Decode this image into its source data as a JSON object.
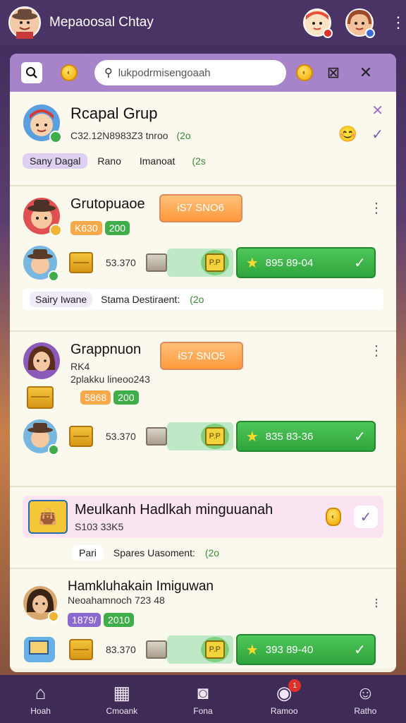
{
  "header": {
    "title": "Mepaoosal Chtay"
  },
  "search": {
    "placeholder": "lukpodrmisengoaah"
  },
  "featured": {
    "name": "Rcapal Grup",
    "meta": "C32.12N8983Z3 tnroo",
    "meta_tag": "(2o",
    "chips": [
      "Sany Dagal",
      "Rano",
      "Imanoat",
      "(2s"
    ]
  },
  "cards": [
    {
      "name": "Grutopuaoe",
      "price": "ɨS7 SNO6",
      "tags": [
        "K630",
        "200"
      ],
      "item_count": "53.370",
      "action_label": "895 89-04",
      "notes": [
        "Sairy Iwane",
        "Stama Destiraent:",
        "(2o"
      ]
    },
    {
      "name": "Grappnuon",
      "subtitle1": "RK4",
      "subtitle2": "2plakku lineoo243",
      "price": "ɨS7 SNO5",
      "tags": [
        "5868",
        "200"
      ],
      "item_count": "53.370",
      "action_label": "835 83-36"
    }
  ],
  "promo": {
    "name": "Meulkanh Hadlkah minguuanah",
    "meta": "S103 33K5",
    "chips": [
      "Pari",
      "Spares Uasoment:",
      "(2o"
    ]
  },
  "last_card": {
    "name": "Hamkluhakain Imiguwan",
    "meta": "Neoahamnoch 723 48",
    "tags": [
      "1879/",
      "2010"
    ],
    "item_count": "83.370",
    "action_label": "393 89-40"
  },
  "nav": [
    {
      "label": "Hoah"
    },
    {
      "label": "Cmoank"
    },
    {
      "label": "Fona"
    },
    {
      "label": "Ramoo",
      "badge": "1"
    },
    {
      "label": "Ratho"
    }
  ],
  "colors": {
    "header_bg": "#4a3466",
    "search_bar_bg": "#a783c9",
    "panel_bg": "#f4f0e2",
    "green_button": "#34a843",
    "orange_button": "#ff9a3c",
    "nav_bg": "#3f2c56"
  }
}
